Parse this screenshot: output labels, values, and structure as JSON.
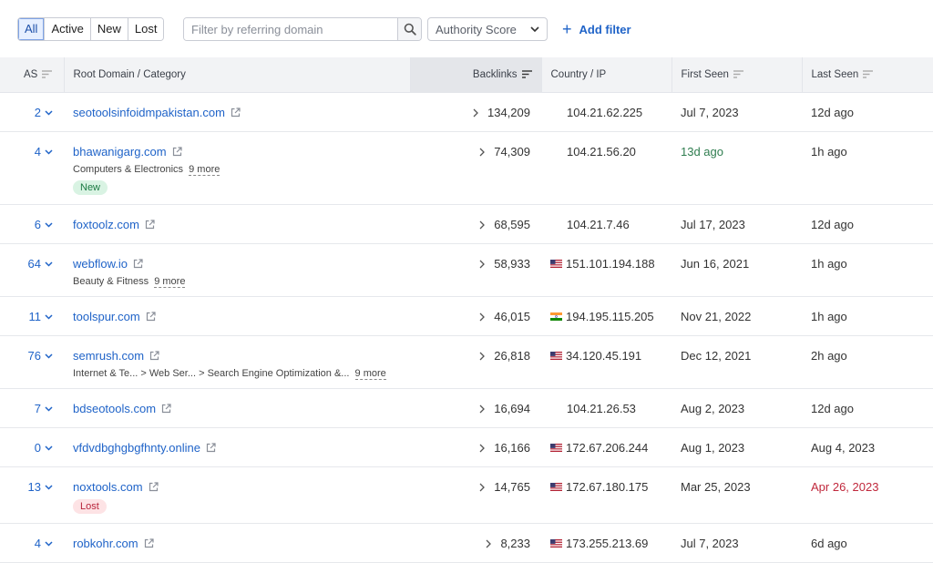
{
  "toolbar": {
    "segments": [
      "All",
      "Active",
      "New",
      "Lost"
    ],
    "active_segment": "All",
    "filter_placeholder": "Filter by referring domain",
    "dropdown_label": "Authority Score",
    "add_filter_label": "Add filter"
  },
  "columns": {
    "as": "AS",
    "domain": "Root Domain / Category",
    "backlinks": "Backlinks",
    "country": "Country / IP",
    "first_seen": "First Seen",
    "last_seen": "Last Seen"
  },
  "colors": {
    "link": "#1f63c8",
    "new_badge_bg": "#d9f3e3",
    "lost_badge_bg": "#fde3e5",
    "recent_green": "#2f7d4f",
    "lost_red": "#c0283c"
  },
  "rows": [
    {
      "as": "2",
      "domain": "seotoolsinfoidmpakistan.com",
      "backlinks": "134,209",
      "flag": "",
      "ip": "104.21.62.225",
      "first_seen": "Jul 7, 2023",
      "last_seen": "12d ago"
    },
    {
      "as": "4",
      "domain": "bhawanigarg.com",
      "category": "Computers & Electronics",
      "more": "9 more",
      "badge": "New",
      "backlinks": "74,309",
      "flag": "",
      "ip": "104.21.56.20",
      "first_seen": "13d ago",
      "first_seen_color": "green",
      "last_seen": "1h ago"
    },
    {
      "as": "6",
      "domain": "foxtoolz.com",
      "backlinks": "68,595",
      "flag": "",
      "ip": "104.21.7.46",
      "first_seen": "Jul 17, 2023",
      "last_seen": "12d ago"
    },
    {
      "as": "64",
      "domain": "webflow.io",
      "category": "Beauty & Fitness",
      "more": "9 more",
      "backlinks": "58,933",
      "flag": "us-flag",
      "ip": "151.101.194.188",
      "first_seen": "Jun 16, 2021",
      "last_seen": "1h ago"
    },
    {
      "as": "11",
      "domain": "toolspur.com",
      "backlinks": "46,015",
      "flag": "in-flag",
      "ip": "194.195.115.205",
      "first_seen": "Nov 21, 2022",
      "last_seen": "1h ago"
    },
    {
      "as": "76",
      "domain": "semrush.com",
      "category": "Internet & Te... > Web Ser... > Search Engine Optimization &...",
      "more": "9 more",
      "backlinks": "26,818",
      "flag": "us-flag",
      "ip": "34.120.45.191",
      "first_seen": "Dec 12, 2021",
      "last_seen": "2h ago"
    },
    {
      "as": "7",
      "domain": "bdseotools.com",
      "backlinks": "16,694",
      "flag": "",
      "ip": "104.21.26.53",
      "first_seen": "Aug 2, 2023",
      "last_seen": "12d ago"
    },
    {
      "as": "0",
      "domain": "vfdvdbghgbgfhnty.online",
      "backlinks": "16,166",
      "flag": "us-flag",
      "ip": "172.67.206.244",
      "first_seen": "Aug 1, 2023",
      "last_seen": "Aug 4, 2023"
    },
    {
      "as": "13",
      "domain": "noxtools.com",
      "badge": "Lost",
      "backlinks": "14,765",
      "flag": "us-flag",
      "ip": "172.67.180.175",
      "first_seen": "Mar 25, 2023",
      "last_seen": "Apr 26, 2023",
      "last_seen_color": "red"
    },
    {
      "as": "4",
      "domain": "robkohr.com",
      "backlinks": "8,233",
      "flag": "us-flag",
      "ip": "173.255.213.69",
      "first_seen": "Jul 7, 2023",
      "last_seen": "6d ago"
    }
  ]
}
